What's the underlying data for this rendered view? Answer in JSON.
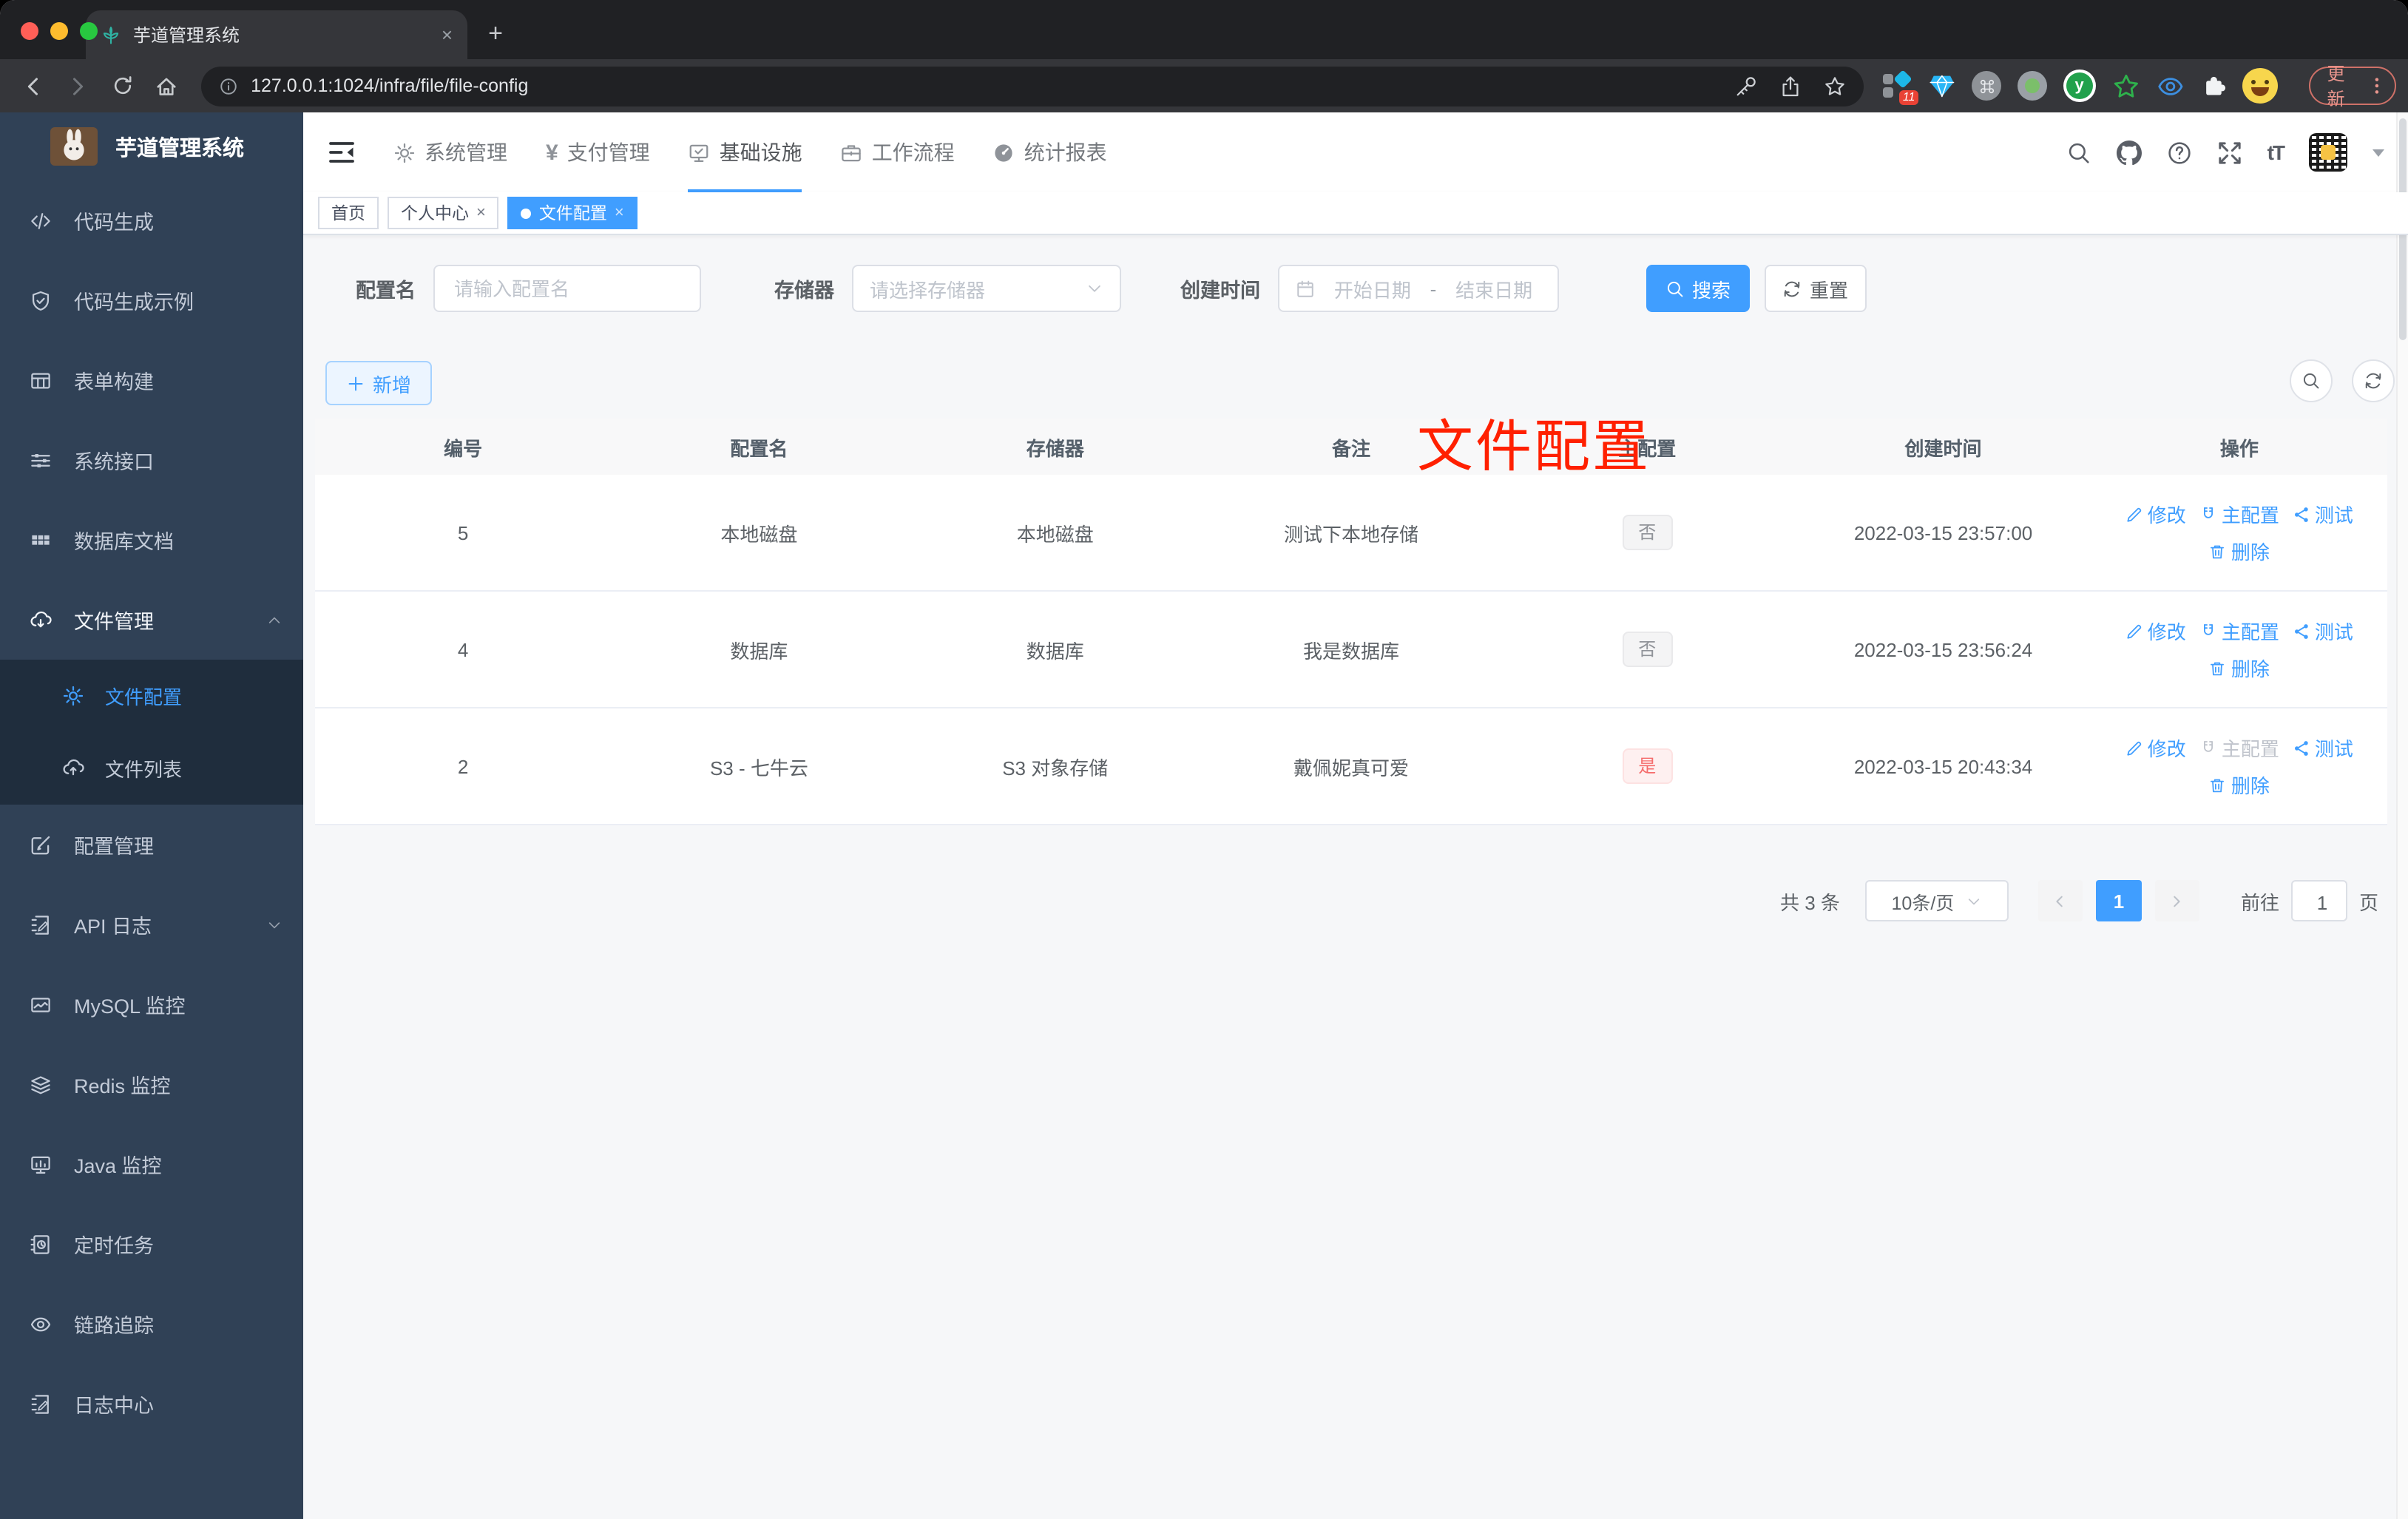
{
  "glyphs": {
    "close": "×",
    "plus": "+",
    "yen": "¥",
    "text_size": "tT"
  },
  "browser": {
    "tab_title": "芋道管理系统",
    "url": "127.0.0.1:1024/infra/file/file-config",
    "ext_badge": "11",
    "ext_y_letter": "y",
    "update_label": "更新"
  },
  "sidebar": {
    "title": "芋道管理系统",
    "items": [
      {
        "label": "代码生成"
      },
      {
        "label": "代码生成示例"
      },
      {
        "label": "表单构建"
      },
      {
        "label": "系统接口"
      },
      {
        "label": "数据库文档"
      },
      {
        "label": "文件管理"
      },
      {
        "label": "配置管理"
      },
      {
        "label": "API 日志"
      },
      {
        "label": "MySQL 监控"
      },
      {
        "label": "Redis 监控"
      },
      {
        "label": "Java 监控"
      },
      {
        "label": "定时任务"
      },
      {
        "label": "链路追踪"
      },
      {
        "label": "日志中心"
      }
    ],
    "sub_items": [
      {
        "label": "文件配置"
      },
      {
        "label": "文件列表"
      }
    ]
  },
  "header": {
    "menus": [
      {
        "label": "系统管理"
      },
      {
        "label": "支付管理"
      },
      {
        "label": "基础设施"
      },
      {
        "label": "工作流程"
      },
      {
        "label": "统计报表"
      }
    ]
  },
  "tags": {
    "tabs": [
      {
        "label": "首页"
      },
      {
        "label": "个人中心"
      },
      {
        "label": "文件配置"
      }
    ]
  },
  "overlay": {
    "text": "文件配置"
  },
  "filter": {
    "name_label": "配置名",
    "name_placeholder": "请输入配置名",
    "storage_label": "存储器",
    "storage_placeholder": "请选择存储器",
    "date_label": "创建时间",
    "date_start_placeholder": "开始日期",
    "date_separator": "-",
    "date_end_placeholder": "结束日期",
    "search_label": "搜索",
    "reset_label": "重置"
  },
  "actions_bar": {
    "add_label": "新增"
  },
  "table": {
    "headers": [
      "编号",
      "配置名",
      "存储器",
      "备注",
      "主配置",
      "创建时间",
      "操作"
    ],
    "actions": {
      "edit": "修改",
      "master": "主配置",
      "test": "测试",
      "delete": "删除"
    },
    "rows": [
      {
        "id": "5",
        "name": "本地磁盘",
        "storage": "本地磁盘",
        "remark": "测试下本地存储",
        "master": "否",
        "created": "2022-03-15 23:57:00"
      },
      {
        "id": "4",
        "name": "数据库",
        "storage": "数据库",
        "remark": "我是数据库",
        "master": "否",
        "created": "2022-03-15 23:56:24"
      },
      {
        "id": "2",
        "name": "S3 - 七牛云",
        "storage": "S3 对象存储",
        "remark": "戴佩妮真可爱",
        "master": "是",
        "created": "2022-03-15 20:43:34"
      }
    ]
  },
  "pagination": {
    "total": "共 3 条",
    "page_size": "10条/页",
    "current": "1",
    "goto": "前往",
    "goto_value": "1",
    "unit": "页"
  },
  "colors": {
    "primary": "#409eff",
    "danger": "#f56c6c",
    "sidebar_bg": "#304156",
    "submenu_bg": "#1f2d3d",
    "red_overlay": "#ff2000"
  }
}
